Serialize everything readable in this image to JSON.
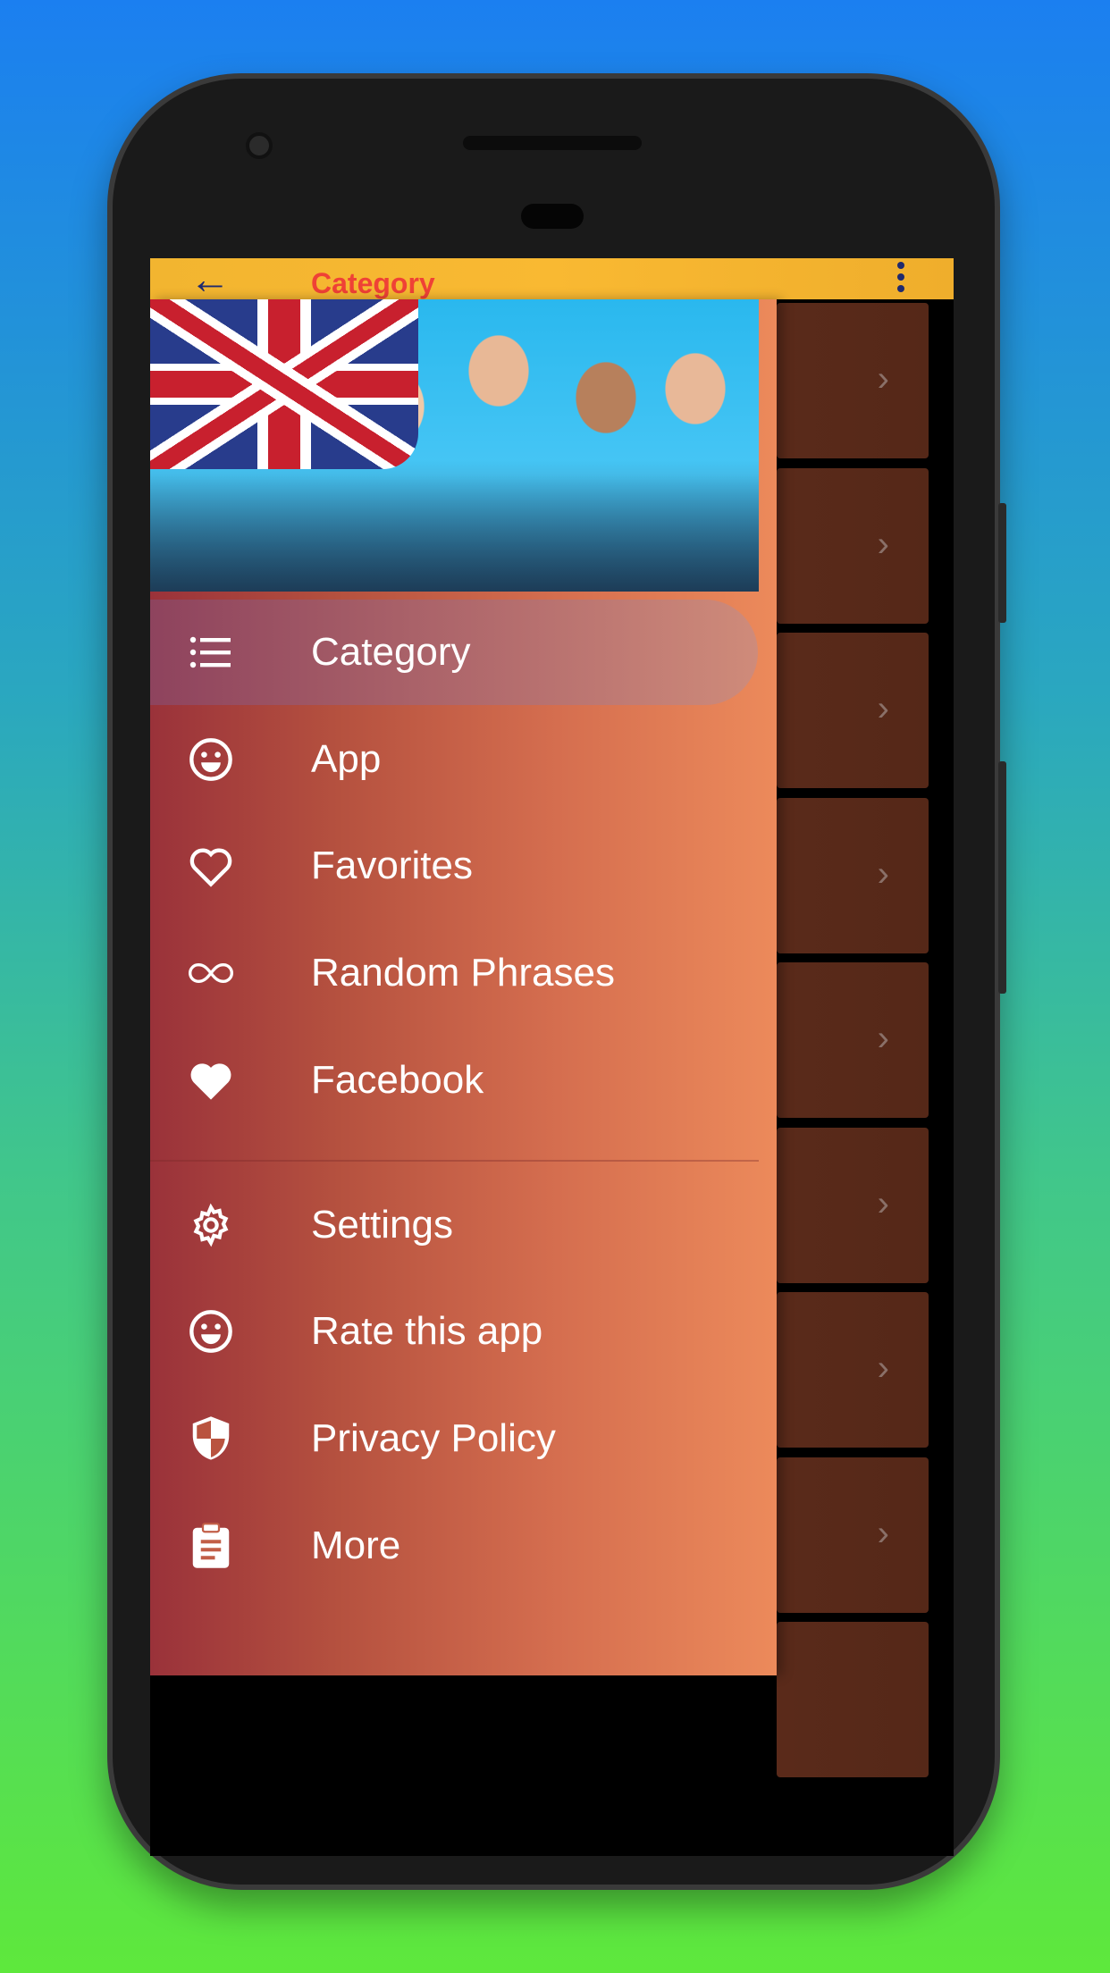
{
  "app_bar": {
    "title": "Category",
    "back_icon": "arrow-left-icon",
    "menu_icon": "more-vert-icon"
  },
  "drawer": {
    "header_image": "uk-flag-students-photo",
    "primary_items": [
      {
        "label": "Category",
        "icon": "list-icon",
        "active": true
      },
      {
        "label": "App",
        "icon": "smiley-icon"
      },
      {
        "label": "Favorites",
        "icon": "heart-outline-icon"
      },
      {
        "label": "Random Phrases",
        "icon": "infinity-icon"
      },
      {
        "label": "Facebook",
        "icon": "heart-filled-icon"
      }
    ],
    "secondary_items": [
      {
        "label": "Settings",
        "icon": "gear-icon"
      },
      {
        "label": "Rate this app",
        "icon": "smiley-icon"
      },
      {
        "label": "Privacy Policy",
        "icon": "shield-icon"
      },
      {
        "label": "More",
        "icon": "clipboard-icon"
      }
    ]
  },
  "colors": {
    "app_bar": "#f9b932",
    "title": "#ef4136",
    "drawer_start": "#9a323a",
    "drawer_end": "#ec8a5b",
    "card": "#5a2a1a"
  }
}
